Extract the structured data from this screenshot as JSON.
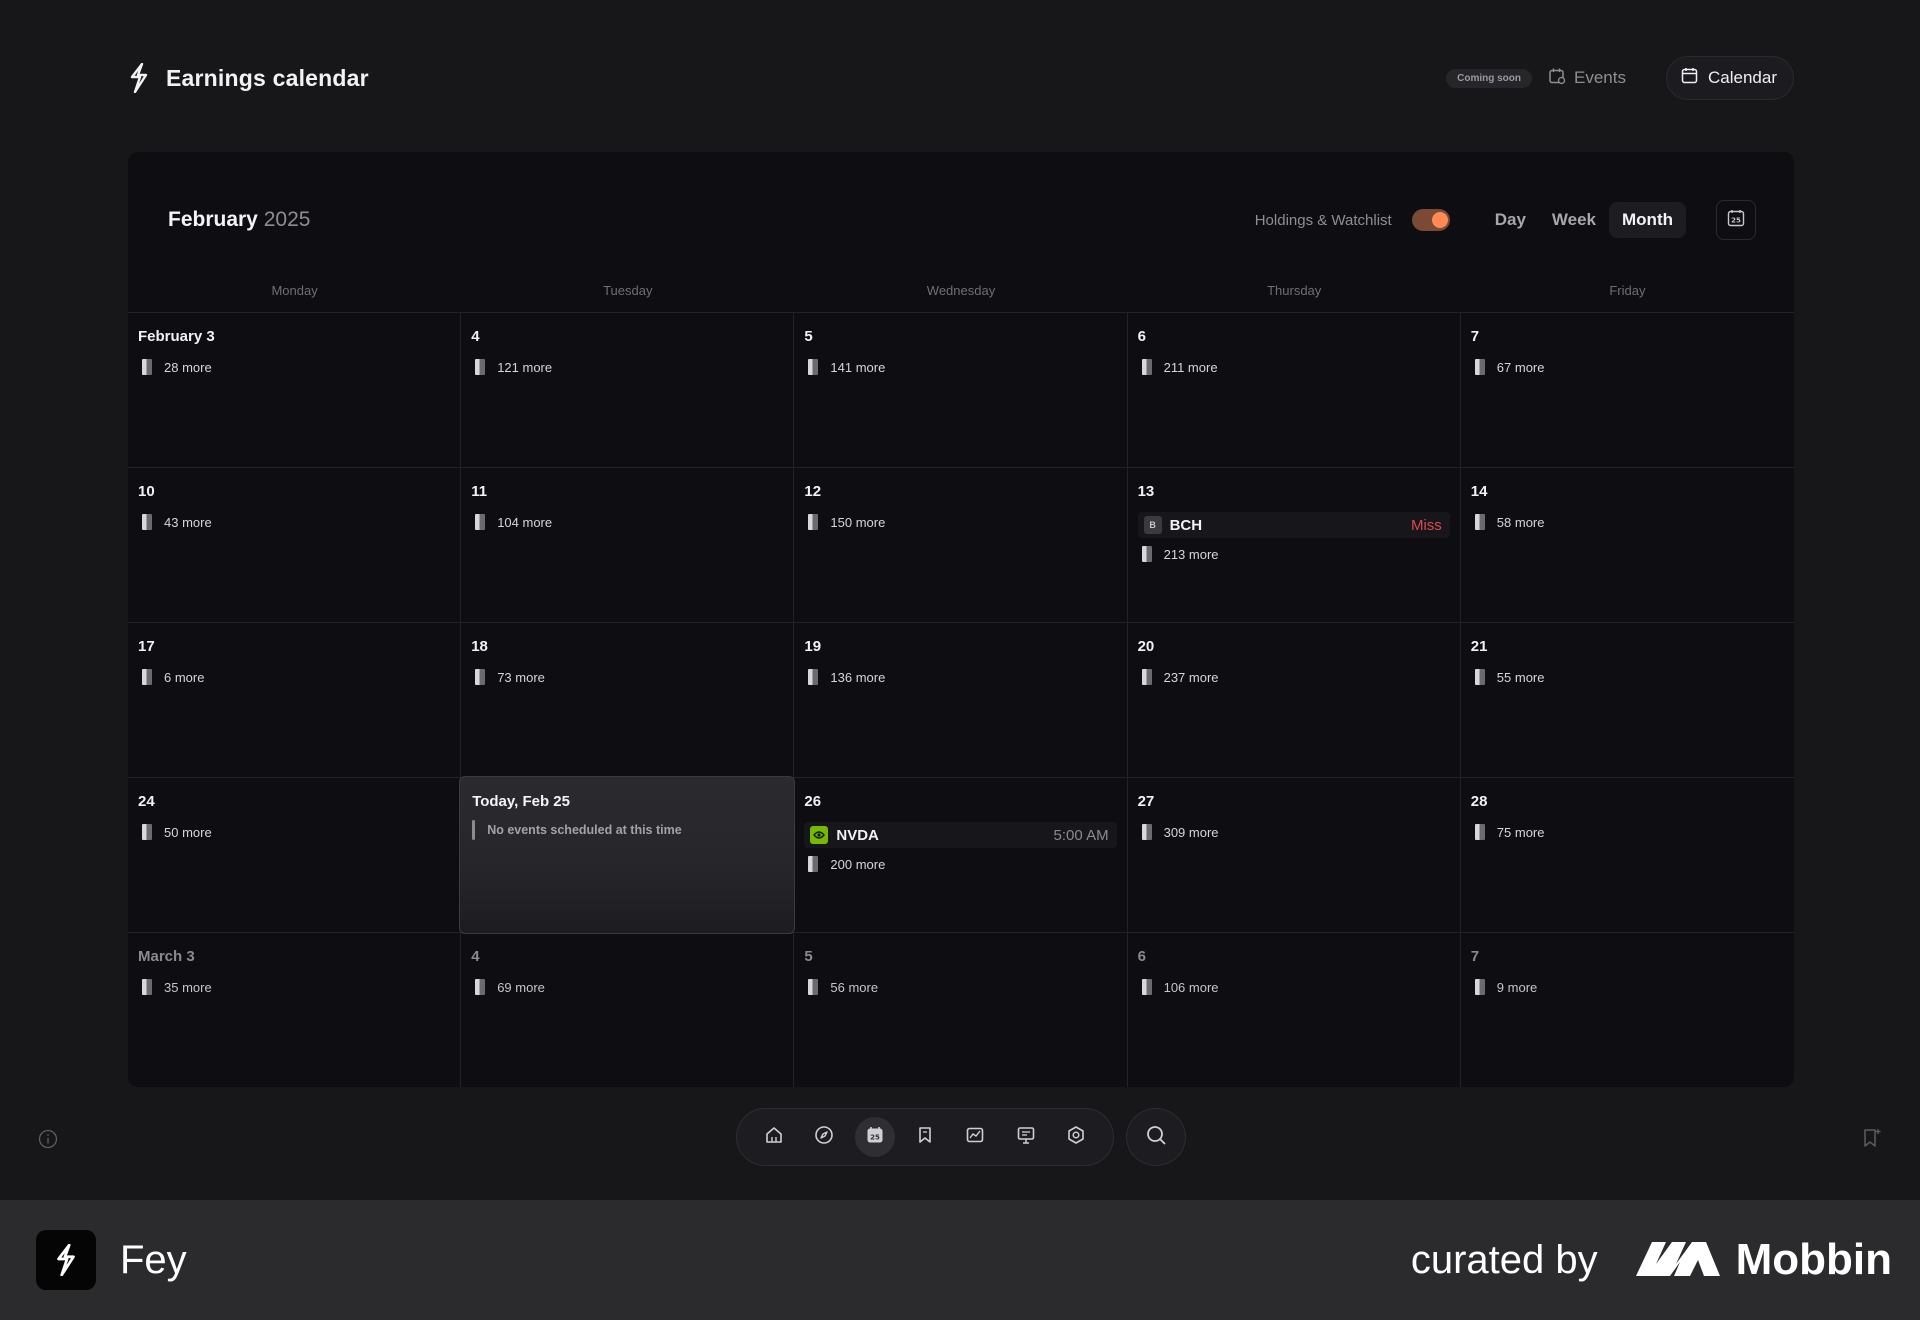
{
  "header": {
    "title": "Earnings calendar",
    "coming_soon": "Coming soon",
    "events_label": "Events",
    "calendar_label": "Calendar"
  },
  "calendar": {
    "month": "February",
    "year": "2025",
    "holdings_label": "Holdings & Watchlist",
    "holdings_on": true,
    "views": [
      "Day",
      "Week",
      "Month"
    ],
    "active_view": "Month",
    "date_icon_text": "25",
    "weekdays": [
      "Monday",
      "Tuesday",
      "Wednesday",
      "Thursday",
      "Friday"
    ],
    "cells": [
      {
        "day": "February 3",
        "more": "28 more"
      },
      {
        "day": "4",
        "more": "121 more"
      },
      {
        "day": "5",
        "more": "141 more"
      },
      {
        "day": "6",
        "more": "211 more"
      },
      {
        "day": "7",
        "more": "67 more"
      },
      {
        "day": "10",
        "more": "43 more"
      },
      {
        "day": "11",
        "more": "104 more"
      },
      {
        "day": "12",
        "more": "150 more"
      },
      {
        "day": "13",
        "more": "213 more",
        "event": {
          "logo": "B",
          "ticker": "BCH",
          "tag": "Miss",
          "tag_type": "miss"
        }
      },
      {
        "day": "14",
        "more": "58 more"
      },
      {
        "day": "17",
        "more": "6 more"
      },
      {
        "day": "18",
        "more": "73 more"
      },
      {
        "day": "19",
        "more": "136 more"
      },
      {
        "day": "20",
        "more": "237 more"
      },
      {
        "day": "21",
        "more": "55 more"
      },
      {
        "day": "24",
        "more": "50 more"
      },
      {
        "today": true,
        "title": "Today, Feb 25",
        "note": "No events scheduled at this time"
      },
      {
        "day": "26",
        "more": "200 more",
        "event": {
          "logo": "N",
          "ticker": "NVDA",
          "tag": "5:00 AM",
          "tag_type": "time"
        }
      },
      {
        "day": "27",
        "more": "309 more"
      },
      {
        "day": "28",
        "more": "75 more"
      },
      {
        "day": "March 3",
        "more": "35 more",
        "dim": true
      },
      {
        "day": "4",
        "more": "69 more",
        "dim": true
      },
      {
        "day": "5",
        "more": "56 more",
        "dim": true
      },
      {
        "day": "6",
        "more": "106 more",
        "dim": true
      },
      {
        "day": "7",
        "more": "9 more",
        "dim": true
      }
    ]
  },
  "dock": {
    "items": [
      "home-icon",
      "compass-icon",
      "calendar-icon",
      "bookmark-icon",
      "chart-icon",
      "presentation-icon",
      "settings-icon"
    ],
    "active": "calendar-icon",
    "calendar_icon_text": "25"
  },
  "footer": {
    "app_name": "Fey",
    "curated_by": "curated by",
    "brand": "Mobbin"
  },
  "colors": {
    "toggle_accent": "#ff8a55",
    "miss": "#e0484e",
    "nvda_green": "#76b900"
  }
}
